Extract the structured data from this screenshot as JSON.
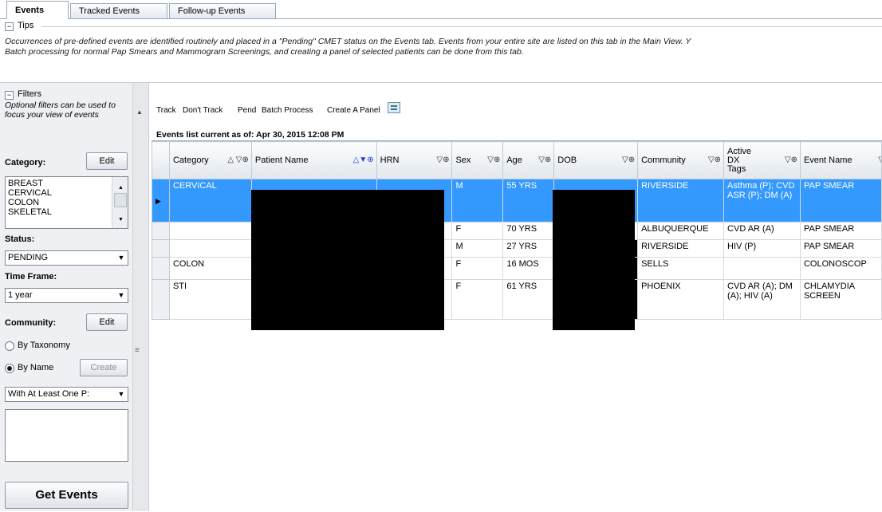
{
  "tabs": [
    "Events",
    "Tracked Events",
    "Follow-up Events"
  ],
  "tips": {
    "label": "Tips",
    "line1": "Occurrences of pre-defined events are identified routinely and placed in a \"Pending\" CMET status on the Events tab.  Events from your entire site are listed on this tab in the Main View.  Y",
    "line2": "Batch processing for normal Pap Smears and Mammogram Screenings, and creating a panel of selected patients can be done from this tab."
  },
  "filters": {
    "label": "Filters",
    "hint": "Optional filters can be used to focus your view of events",
    "category_label": "Category:",
    "edit_label": "Edit",
    "categories": [
      "BREAST",
      "CERVICAL",
      "COLON",
      "SKELETAL"
    ],
    "status_label": "Status:",
    "status_value": "PENDING",
    "timeframe_label": "Time Frame:",
    "timeframe_value": "1 year",
    "community_label": "Community:",
    "community_edit_label": "Edit",
    "by_taxonomy": "By Taxonomy",
    "by_name": "By Name",
    "create_label": "Create",
    "patient_filter": "With At Least One P:",
    "get_events": "Get Events"
  },
  "toolbar": {
    "track": "Track",
    "dont_track": "Don't Track",
    "pend": "Pend",
    "batch": "Batch Process",
    "panel": "Create A Panel"
  },
  "as_of": "Events list current as of: Apr 30, 2015 12:08 PM",
  "columns": [
    "Category",
    "Patient Name",
    "HRN",
    "Sex",
    "Age",
    "DOB",
    "Community",
    "Active DX Tags",
    "Event Name"
  ],
  "rows": [
    {
      "category": "CERVICAL",
      "sex": "M",
      "age": "55 YRS",
      "community": "RIVERSIDE",
      "dx": "Asthma (P); CVD ASR (P); DM (A)",
      "event": "PAP SMEAR"
    },
    {
      "category": "",
      "sex": "F",
      "age": "70 YRS",
      "community": "ALBUQUERQUE",
      "dx": "CVD AR (A)",
      "event": "PAP SMEAR"
    },
    {
      "category": "",
      "sex": "M",
      "age": "27 YRS",
      "community": "RIVERSIDE",
      "dx": "HIV (P)",
      "event": "PAP SMEAR"
    },
    {
      "category": "COLON",
      "sex": "F",
      "age": "16 MOS",
      "community": "SELLS",
      "dx": "",
      "event": "COLONOSCOP"
    },
    {
      "category": "STI",
      "sex": "F",
      "age": "61 YRS",
      "community": "PHOENIX",
      "dx": "CVD AR (A); DM (A); HIV (A)",
      "event": "CHLAMYDIA SCREEN"
    }
  ],
  "colors": {
    "selection": "#3399ff",
    "panel_bg": "#eef0f3"
  }
}
